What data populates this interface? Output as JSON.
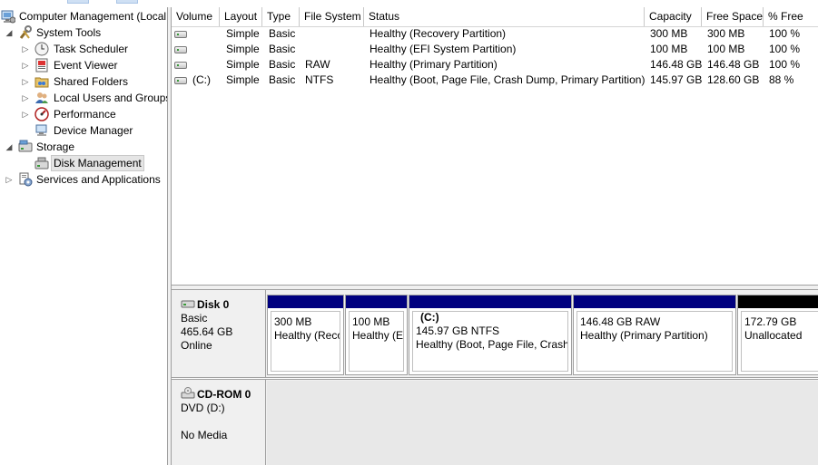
{
  "tree": {
    "root": "Computer Management (Local",
    "system_tools": "System Tools",
    "task_scheduler": "Task Scheduler",
    "event_viewer": "Event Viewer",
    "shared_folders": "Shared Folders",
    "local_users": "Local Users and Groups",
    "performance": "Performance",
    "device_manager": "Device Manager",
    "storage": "Storage",
    "disk_management": "Disk Management",
    "services": "Services and Applications"
  },
  "columns": [
    "Volume",
    "Layout",
    "Type",
    "File System",
    "Status",
    "Capacity",
    "Free Space",
    "% Free"
  ],
  "volumes": [
    {
      "volume": "",
      "layout": "Simple",
      "type": "Basic",
      "fs": "",
      "status": "Healthy (Recovery Partition)",
      "capacity": "300 MB",
      "free": "300 MB",
      "pct": "100 %"
    },
    {
      "volume": "",
      "layout": "Simple",
      "type": "Basic",
      "fs": "",
      "status": "Healthy (EFI System Partition)",
      "capacity": "100 MB",
      "free": "100 MB",
      "pct": "100 %"
    },
    {
      "volume": "",
      "layout": "Simple",
      "type": "Basic",
      "fs": "RAW",
      "status": "Healthy (Primary Partition)",
      "capacity": "146.48 GB",
      "free": "146.48 GB",
      "pct": "100 %"
    },
    {
      "volume": "(C:)",
      "layout": "Simple",
      "type": "Basic",
      "fs": "NTFS",
      "status": "Healthy (Boot, Page File, Crash Dump, Primary Partition)",
      "capacity": "145.97 GB",
      "free": "128.60 GB",
      "pct": "88 %"
    }
  ],
  "disk0": {
    "name": "Disk 0",
    "type": "Basic",
    "size": "465.64 GB",
    "state": "Online",
    "partitions": [
      {
        "title": "",
        "size": "300 MB",
        "status": "Healthy (Reco"
      },
      {
        "title": "",
        "size": "100 MB",
        "status": "Healthy (E"
      },
      {
        "title": "(C:)",
        "size": "145.97 GB NTFS",
        "status": "Healthy (Boot, Page File, Crash"
      },
      {
        "title": "",
        "size": "146.48 GB RAW",
        "status": "Healthy (Primary Partition)"
      },
      {
        "title": "",
        "size": "172.79 GB",
        "status": "Unallocated"
      }
    ]
  },
  "cdrom0": {
    "name": "CD-ROM 0",
    "drive": "DVD (D:)",
    "media": "No Media"
  },
  "colors": {
    "partition_header": "#00007f",
    "unallocated_header": "#000000",
    "panel_bg": "#f0f0f0"
  }
}
